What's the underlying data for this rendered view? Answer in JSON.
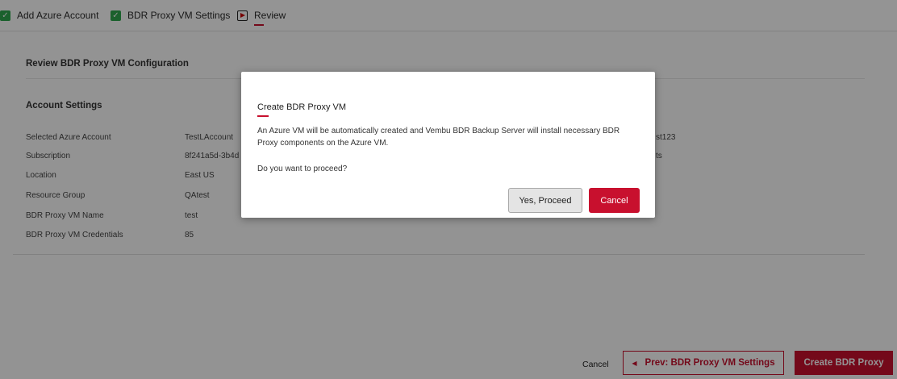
{
  "steps": [
    {
      "label": "Add Azure Account",
      "status": "done"
    },
    {
      "label": "BDR Proxy VM Settings",
      "status": "done"
    },
    {
      "label": "Review",
      "status": "active"
    }
  ],
  "review": {
    "title": "Review BDR Proxy VM Configuration",
    "section_title": "Account Settings",
    "rows": [
      {
        "key": "Selected Azure Account",
        "value": "TestLAccount"
      },
      {
        "key": "Subscription",
        "value": "8f241a5d-3b4d"
      },
      {
        "key": "Location",
        "value": "East US"
      },
      {
        "key": "Resource Group",
        "value": "QAtest"
      },
      {
        "key": "BDR Proxy VM Name",
        "value": "test"
      },
      {
        "key": "BDR Proxy VM Credentials",
        "value": "85"
      }
    ],
    "right_values": [
      "st123",
      "ts"
    ]
  },
  "footer": {
    "cancel": "Cancel",
    "prev": "Prev: BDR Proxy VM Settings",
    "create": "Create BDR Proxy"
  },
  "modal": {
    "title": "Create BDR Proxy VM",
    "body": "An Azure VM will be automatically created and Vembu BDR Backup Server will install necessary BDR Proxy components on the Azure VM.",
    "question": "Do you want to proceed?",
    "yes": "Yes, Proceed",
    "cancel": "Cancel"
  },
  "colors": {
    "accent": "#c8102e",
    "check": "#2fa84f"
  }
}
